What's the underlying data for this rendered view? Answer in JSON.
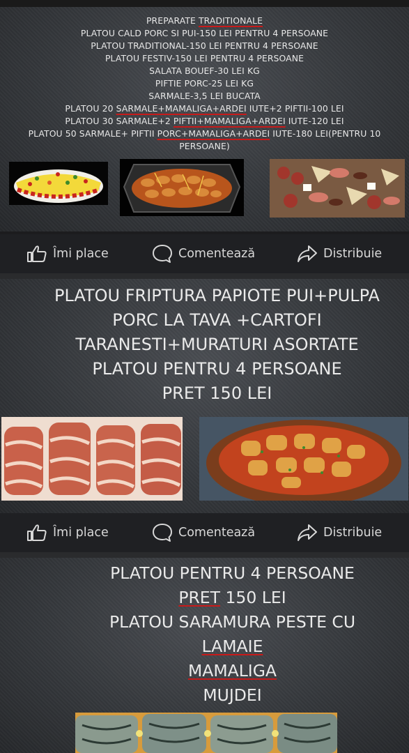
{
  "post1": {
    "lines": [
      [
        {
          "t": "PREPARATE "
        },
        {
          "t": "TRADITIONALE",
          "u": true
        }
      ],
      [
        {
          "t": "PLATOU CALD PORC SI PUI-150 LEI PENTRU 4 PERSOANE"
        }
      ],
      [
        {
          "t": "PLATOU TRADITIONAL-150 LEI PENTRU 4 PERSOANE"
        }
      ],
      [
        {
          "t": "PLATOU FESTIV-150 LEI PENTRU 4 PERSOANE"
        }
      ],
      [
        {
          "t": "SALATA BOUEF-30 LEI KG"
        }
      ],
      [
        {
          "t": "PIFTIE PORC-25 LEI KG"
        }
      ],
      [
        {
          "t": "SARMALE-3,5 LEI BUCATA"
        }
      ],
      [
        {
          "t": "PLATOU 20 "
        },
        {
          "t": "SARMALE+MAMALIGA+ARDEI",
          "u": true
        },
        {
          "t": " IUTE+2 PIFTII-100 LEI"
        }
      ],
      [
        {
          "t": "PLATOU 30 SARMALE+2 "
        },
        {
          "t": "PIFTII+MAMALIGA+ARDEI",
          "u": true
        },
        {
          "t": " IUTE-120 LEI"
        }
      ],
      [
        {
          "t": "PLATOU 50 SARMALE+ PIFTII "
        },
        {
          "t": "PORC+MAMALIGA+ARDEI",
          "u": true
        },
        {
          "t": " IUTE-180 LEI(PENTRU 10"
        }
      ],
      [
        {
          "t": "PERSOANE)"
        }
      ]
    ]
  },
  "post2": {
    "lines": [
      [
        {
          "t": "PLATOU FRIPTURA PAPIOTE PUI+PULPA"
        }
      ],
      [
        {
          "t": "PORC LA TAVA +CARTOFI"
        }
      ],
      [
        {
          "t": "TARANESTI+MURATURI ASORTATE"
        }
      ],
      [
        {
          "t": "PLATOU PENTRU 4 PERSOANE"
        }
      ],
      [
        {
          "t": "PRET 150 LEI"
        }
      ]
    ]
  },
  "post3": {
    "lines": [
      [
        {
          "t": "PLATOU PENTRU 4 PERSOANE"
        }
      ],
      [
        {
          "t": "PRET",
          "u": true
        },
        {
          "t": " 150 LEI"
        }
      ],
      [
        {
          "t": "PLATOU SARAMURA PESTE CU"
        }
      ],
      [
        {
          "t": "LAMAIE",
          "u": true
        }
      ],
      [
        {
          "t": "MAMALIGA",
          "u": true
        }
      ],
      [
        {
          "t": "MUJDEI"
        }
      ]
    ]
  },
  "actions": {
    "like_label": "Îmi place",
    "comment_label": "Comentează",
    "share_label": "Distribuie"
  },
  "icons": {
    "like": "thumbs-up-icon",
    "comment": "speech-bubble-icon",
    "share": "share-arrow-icon"
  },
  "colors": {
    "action_bar": "#1f2023",
    "text": "#e8e8e8",
    "underline": "#c81a1a"
  }
}
